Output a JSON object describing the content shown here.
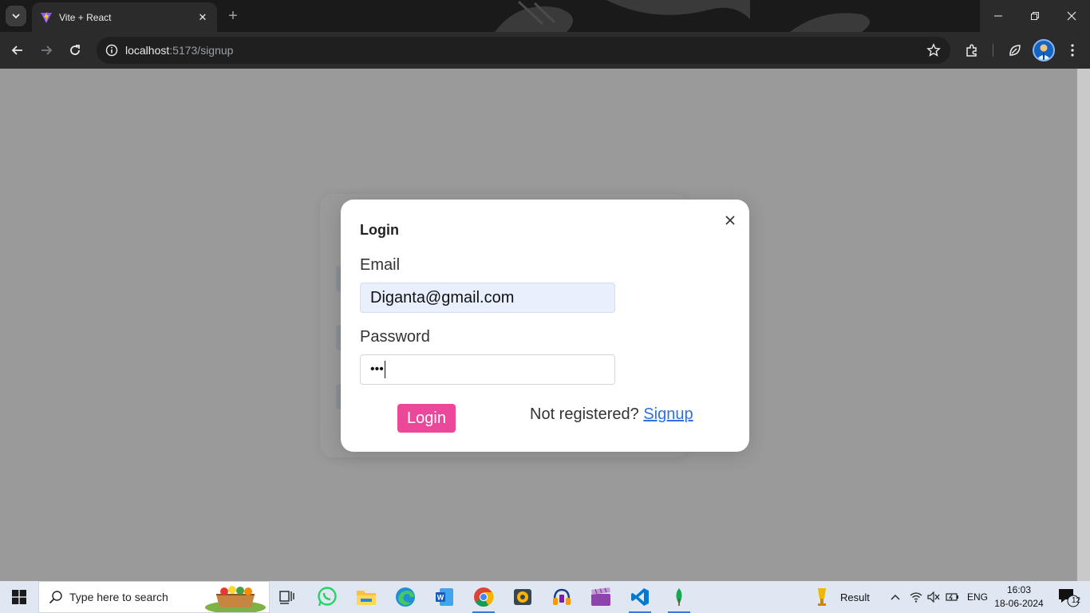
{
  "browser": {
    "tab_title": "Vite + React",
    "url_host": "localhost",
    "url_rest": ":5173/signup"
  },
  "modal": {
    "title": "Login",
    "email_label": "Email",
    "email_value": "Diganta@gmail.com",
    "password_label": "Password",
    "password_masked": "•••",
    "login_button": "Login",
    "not_registered_text": "Not registered?",
    "signup_link": "Signup"
  },
  "taskbar": {
    "search_placeholder": "Type here to search",
    "weather_label": "Result",
    "language": "ENG",
    "time": "16:03",
    "date": "18-06-2024",
    "notification_count": "12"
  },
  "colors": {
    "accent_button": "#ec4899",
    "link": "#2f6fe0",
    "overlay": "#9a9a9a"
  }
}
